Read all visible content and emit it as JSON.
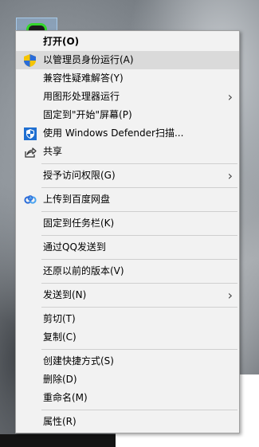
{
  "menu": {
    "items": [
      {
        "label": "打开(O)"
      },
      {
        "label": "以管理员身份运行(A)"
      },
      {
        "label": "兼容性疑难解答(Y)"
      },
      {
        "label": "用图形处理器运行"
      },
      {
        "label": "固定到\"开始\"屏幕(P)"
      },
      {
        "label": "使用 Windows Defender扫描..."
      },
      {
        "label": "共享"
      },
      {
        "label": "授予访问权限(G)"
      },
      {
        "label": "上传到百度网盘"
      },
      {
        "label": "固定到任务栏(K)"
      },
      {
        "label": "通过QQ发送到"
      },
      {
        "label": "还原以前的版本(V)"
      },
      {
        "label": "发送到(N)"
      },
      {
        "label": "剪切(T)"
      },
      {
        "label": "复制(C)"
      },
      {
        "label": "创建快捷方式(S)"
      },
      {
        "label": "删除(D)"
      },
      {
        "label": "重命名(M)"
      },
      {
        "label": "属性(R)"
      }
    ]
  },
  "colors": {
    "menu_bg": "#f2f2f2",
    "highlight": "#dadada",
    "defender_blue": "#1f6fd1",
    "baidu_blue": "#2b6cd9",
    "desktop_icon_green": "#34d62c"
  }
}
